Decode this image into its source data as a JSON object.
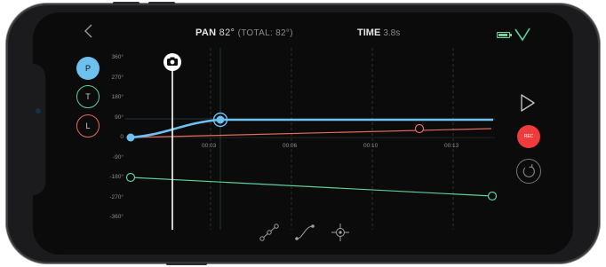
{
  "header": {
    "pan_label": "PAN",
    "pan_value": "82°",
    "pan_total": "(TOTAL: 82°)",
    "time_label": "TIME",
    "time_value": "3.8s",
    "battery_level": 0.9
  },
  "axes": {
    "items": [
      {
        "label": "P",
        "color": "#6ec1ee"
      },
      {
        "label": "T",
        "color": "#5fcf9d"
      },
      {
        "label": "L",
        "color": "#e36b5a"
      }
    ]
  },
  "graph": {
    "y_ticks": [
      "360°",
      "270°",
      "180°",
      "90°",
      "0",
      "-90°",
      "-180°",
      "-270°",
      "-360°"
    ],
    "x_ticks": [
      "00:03",
      "00:06",
      "00:10",
      "00:13"
    ],
    "colors": {
      "pan": "#6ec1ee",
      "tilt": "#5fcf9d",
      "lens": "#e36b5a"
    }
  },
  "controls": {
    "rec_label": "REC"
  },
  "icons": {
    "back": "chevron-left-icon",
    "confirm": "checkmark-icon",
    "camera": "camera-icon",
    "play": "play-icon",
    "loop": "loop-icon",
    "linear": "linear-curve-icon",
    "ease": "ease-curve-icon",
    "target": "crosshair-icon"
  }
}
